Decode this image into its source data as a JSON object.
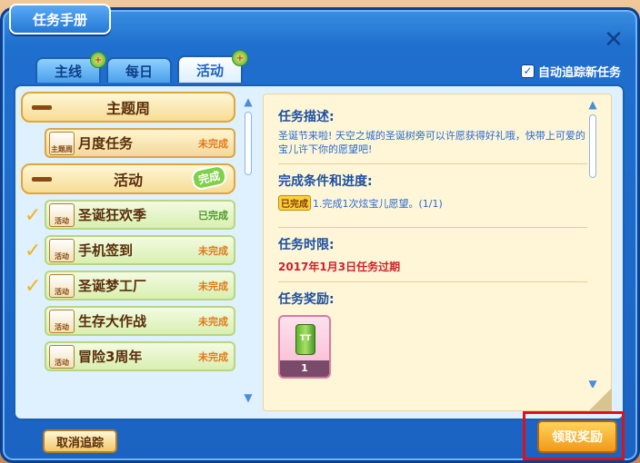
{
  "window": {
    "title": "任务手册"
  },
  "tabs": [
    {
      "label": "主线",
      "gift": "+"
    },
    {
      "label": "每日",
      "gift": ""
    },
    {
      "label": "活动",
      "gift": "+"
    }
  ],
  "auto_track": {
    "label": "自动追踪新任务",
    "checked": "✓"
  },
  "groups": {
    "themed": {
      "title": "主题周"
    },
    "activity": {
      "title": "活动",
      "badge": "完成"
    }
  },
  "themed_tasks": [
    {
      "icon": "主题周",
      "name": "月度任务",
      "status": "未完成"
    }
  ],
  "activity_tasks": [
    {
      "icon": "活动",
      "name": "圣诞狂欢季",
      "status": "已完成",
      "check": "✓"
    },
    {
      "icon": "活动",
      "name": "手机签到",
      "status": "未完成",
      "check": "✓"
    },
    {
      "icon": "活动",
      "name": "圣诞梦工厂",
      "status": "未完成",
      "check": "✓"
    },
    {
      "icon": "活动",
      "name": "生存大作战",
      "status": "未完成",
      "check": ""
    },
    {
      "icon": "活动",
      "name": "冒险3周年",
      "status": "未完成",
      "check": ""
    }
  ],
  "detail": {
    "desc_head": "任务描述:",
    "desc_text": "圣诞节来啦! 天空之城的圣诞树旁可以许愿获得好礼哦，快带上可爱的宝儿许下你的愿望吧!",
    "cond_head": "完成条件和进度:",
    "cond_badge": "已完成",
    "cond_text": "1.完成1次炫宝儿愿望。(1/1)",
    "limit_head": "任务时限:",
    "limit_text": "2017年1月3日任务过期",
    "reward_head": "任务奖励:",
    "reward_count": "1",
    "reward_can_label": "TT"
  },
  "buttons": {
    "cancel_track": "取消追踪",
    "claim": "领取奖励"
  },
  "colors": {
    "frame": "#1b63c2",
    "panel": "#dff0ff",
    "detail_bg": "#fff6d8",
    "highlight": "#e0101a"
  }
}
